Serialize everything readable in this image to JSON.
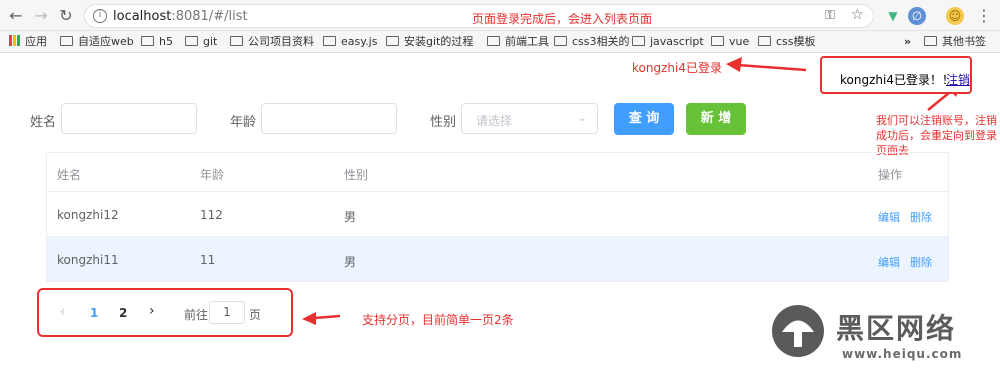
{
  "browser": {
    "url_host": "localhost",
    "url_rest": ":8081/#/list",
    "bookmarks": [
      "应用",
      "自适应web",
      "h5",
      "git",
      "公司项目资料",
      "easy.js",
      "安装git的过程",
      "前端工具",
      "css3相关的",
      "javascript",
      "vue",
      "css模板",
      "»",
      "其他书签"
    ]
  },
  "annotations": {
    "top_note": "页面登录完成后，会进入列表页面",
    "login_note": "kongzhi4已登录",
    "logout_note": "我们可以注销账号，注销成功后，会重定向到登录页面去",
    "pager_note": "支持分页，目前简单一页2条"
  },
  "login": {
    "text": "kongzhi4已登录！！",
    "logout": "注销"
  },
  "form": {
    "name_label": "姓名",
    "age_label": "年龄",
    "gender_label": "性别",
    "gender_placeholder": "请选择",
    "query_button": "查 询",
    "add_button": "新 增"
  },
  "table": {
    "columns": [
      "姓名",
      "年龄",
      "性别",
      "操作"
    ],
    "rows": [
      {
        "name": "kongzhi12",
        "age": "112",
        "gender": "男",
        "edit": "编辑",
        "delete": "删除"
      },
      {
        "name": "kongzhi11",
        "age": "11",
        "gender": "男",
        "edit": "编辑",
        "delete": "删除"
      }
    ]
  },
  "pagination": {
    "prev": "‹",
    "pages": [
      "1",
      "2"
    ],
    "next": "›",
    "goto_label": "前往",
    "goto_value": "1",
    "page_suffix": "页"
  },
  "watermark": {
    "text": "黑区网络",
    "url": "www.heiqu.com"
  },
  "colors": {
    "primary": "#409eff",
    "success": "#67c23a",
    "annotation": "#e8302f"
  }
}
